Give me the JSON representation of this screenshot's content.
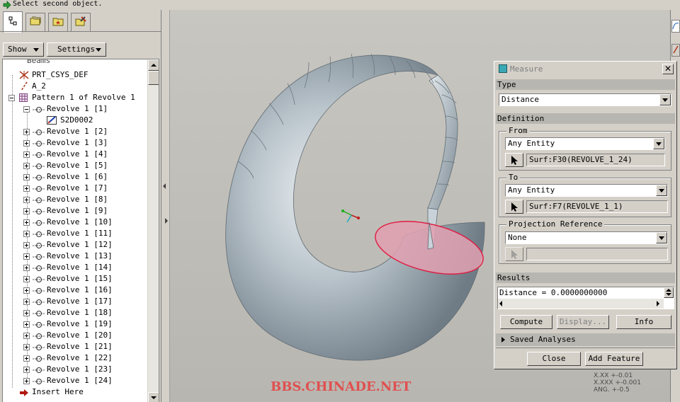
{
  "status": {
    "message": "Select second object."
  },
  "left_panel": {
    "show_button": "Show",
    "settings_button": "Settings",
    "tree": {
      "cut_off_top": "Beams",
      "csys": "PRT_CSYS_DEF",
      "axis": "A_2",
      "pattern": "Pattern 1 of Revolve 1",
      "first_child": "Revolve 1 [1]",
      "sketch": "S2D0002",
      "revolves": [
        "Revolve 1 [2]",
        "Revolve 1 [3]",
        "Revolve 1 [4]",
        "Revolve 1 [5]",
        "Revolve 1 [6]",
        "Revolve 1 [7]",
        "Revolve 1 [8]",
        "Revolve 1 [9]",
        "Revolve 1 [10]",
        "Revolve 1 [11]",
        "Revolve 1 [12]",
        "Revolve 1 [13]",
        "Revolve 1 [14]",
        "Revolve 1 [15]",
        "Revolve 1 [16]",
        "Revolve 1 [17]",
        "Revolve 1 [18]",
        "Revolve 1 [19]",
        "Revolve 1 [20]",
        "Revolve 1 [21]",
        "Revolve 1 [22]",
        "Revolve 1 [23]",
        "Revolve 1 [24]"
      ],
      "insert_here": "Insert Here"
    }
  },
  "viewport": {
    "watermark": "BBS.CHINADE.NET",
    "tolerance": [
      "X.XX +-0.01",
      "X.XXX +-0.001",
      "ANG. +-0.5"
    ]
  },
  "dialog": {
    "title": "Measure",
    "type_label": "Type",
    "type_value": "Distance",
    "definition_label": "Definition",
    "from_label": "From",
    "from_combo": "Any Entity",
    "from_value": "Surf:F30(REVOLVE_1_24)",
    "to_label": "To",
    "to_combo": "Any Entity",
    "to_value": "Surf:F7(REVOLVE_1_1)",
    "projection_label": "Projection Reference",
    "projection_combo": "None",
    "results_label": "Results",
    "results_value": "Distance = 0.0000000000",
    "compute": "Compute",
    "display": "Display...",
    "info": "Info",
    "saved_analyses": "Saved Analyses",
    "close": "Close",
    "add_feature": "Add Feature"
  },
  "colors": {
    "model": "#a5b0b8",
    "selected_face": "#e0a0b0",
    "accent_teal": "#3aa9b5",
    "watermark": "#e05050"
  }
}
